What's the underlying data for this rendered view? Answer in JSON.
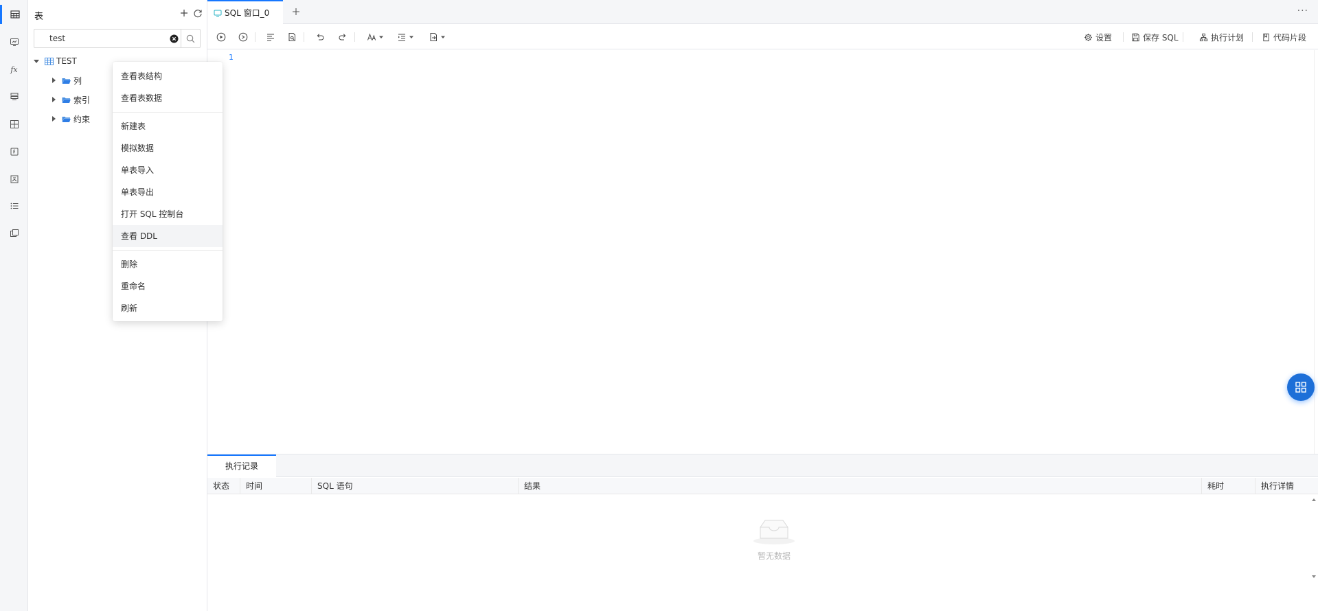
{
  "colors": {
    "accent": "#1677ff",
    "float_button": "#1d6fd8",
    "line_number": "#1677ff"
  },
  "rail": {
    "items": [
      {
        "name": "table-icon",
        "active": true
      },
      {
        "name": "view-icon"
      },
      {
        "name": "function-icon",
        "text": "fx"
      },
      {
        "name": "procedure-icon"
      },
      {
        "name": "grid-icon"
      },
      {
        "name": "package-icon"
      },
      {
        "name": "trigger-icon"
      },
      {
        "name": "list-icon"
      },
      {
        "name": "copy-icon"
      }
    ]
  },
  "object_panel": {
    "title": "表",
    "search": {
      "value": "test",
      "placeholder": ""
    },
    "tree": {
      "root": "TEST",
      "children": [
        "列",
        "索引",
        "约束"
      ]
    }
  },
  "context_menu": {
    "items": [
      "查看表结构",
      "查看表数据",
      "新建表",
      "模拟数据",
      "单表导入",
      "单表导出",
      "打开 SQL 控制台",
      "查看 DDL",
      "删除",
      "重命名",
      "刷新"
    ],
    "highlighted": "查看 DDL"
  },
  "tabs": {
    "active_label": "SQL 窗口_0",
    "more": "···"
  },
  "toolbar": {
    "settings": "设置",
    "save_sql": "保存 SQL",
    "exec_plan": "执行计划",
    "snippets": "代码片段"
  },
  "editor": {
    "line_number": "1"
  },
  "bottom": {
    "tab": "执行记录",
    "columns": [
      "状态",
      "时间",
      "SQL 语句",
      "结果",
      "耗时",
      "执行详情"
    ],
    "empty_text": "暂无数据"
  }
}
